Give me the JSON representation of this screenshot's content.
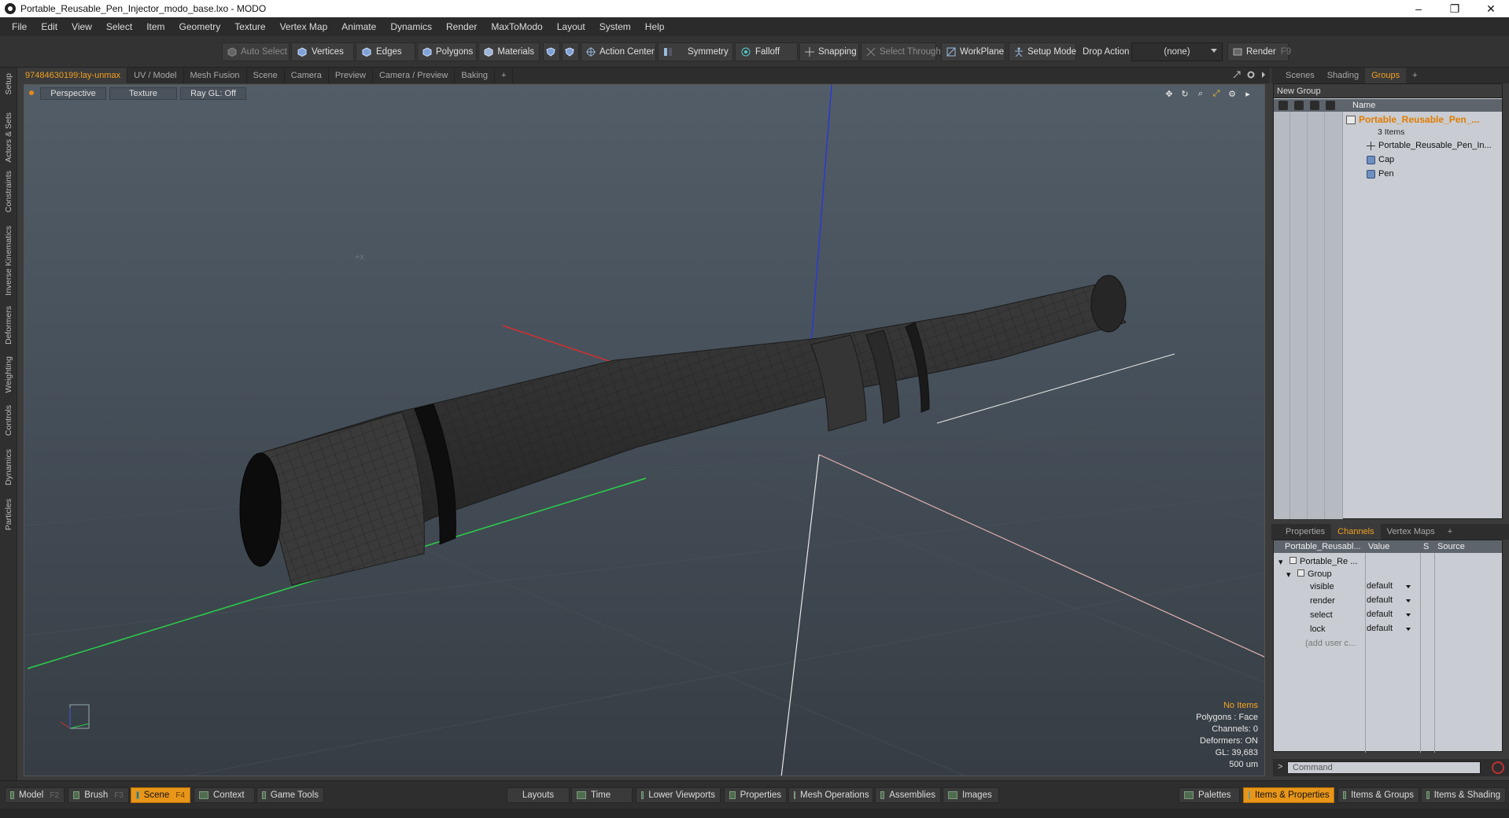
{
  "window": {
    "title": "Portable_Reusable_Pen_Injector_modo_base.lxo - MODO",
    "buttons": {
      "minimize": "–",
      "restore": "❐",
      "close": "✕"
    }
  },
  "menu": [
    "File",
    "Edit",
    "View",
    "Select",
    "Item",
    "Geometry",
    "Texture",
    "Vertex Map",
    "Animate",
    "Dynamics",
    "Render",
    "MaxToModo",
    "Layout",
    "System",
    "Help"
  ],
  "toolbar": {
    "auto_select": "Auto Select",
    "vertices": "Vertices",
    "edges": "Edges",
    "polygons": "Polygons",
    "materials": "Materials",
    "action_center": "Action Center",
    "symmetry": "Symmetry",
    "falloff": "Falloff",
    "snapping": "Snapping",
    "select_through": "Select Through",
    "workplane": "WorkPlane",
    "setup_mode": "Setup Mode",
    "drop_action": "Drop Action",
    "drop_action_value": "(none)",
    "render": "Render",
    "render_key": "F9"
  },
  "left_tabs": [
    "Setup",
    "Actors & Sets",
    "Constraints",
    "Inverse Kinematics",
    "Deformers",
    "Weighting",
    "Controls",
    "Dynamics",
    "Particles"
  ],
  "viewport_tabs": [
    "97484630199:lay-unmax",
    "UV / Model",
    "Mesh Fusion",
    "Scene",
    "Camera",
    "Preview",
    "Camera / Preview",
    "Baking",
    "+"
  ],
  "viewport": {
    "view": "Perspective",
    "shading": "Texture",
    "raygl": "Ray GL: Off",
    "stats": {
      "items": "No Items",
      "polygons": "Polygons : Face",
      "channels": "Channels: 0",
      "deformers": "Deformers: ON",
      "gl": "GL: 39,683",
      "scale": "500 um"
    }
  },
  "right_top_tabs": [
    "Scenes",
    "Shading",
    "Groups",
    "+"
  ],
  "groups": {
    "new_group": "New Group",
    "name_header": "Name",
    "root": "Portable_Reusable_Pen_...",
    "root_count": "3 Items",
    "children": [
      "Portable_Reusable_Pen_In...",
      "Cap",
      "Pen"
    ]
  },
  "right_mid_tabs": [
    "Properties",
    "Channels",
    "Vertex Maps",
    "+"
  ],
  "channels": {
    "headers": {
      "name": "Portable_Reusabl...",
      "value": "Value",
      "s": "S",
      "source": "Source"
    },
    "tree_root": "Portable_Re ...",
    "group": "Group",
    "rows": [
      {
        "name": "visible",
        "value": "default"
      },
      {
        "name": "render",
        "value": "default"
      },
      {
        "name": "select",
        "value": "default"
      },
      {
        "name": "lock",
        "value": "default"
      }
    ],
    "add_user": "(add user c..."
  },
  "command": {
    "prompt": ">",
    "placeholder": "Command"
  },
  "bottom": {
    "model": "Model",
    "model_key": "F2",
    "brush": "Brush",
    "brush_key": "F3",
    "scene": "Scene",
    "scene_key": "F4",
    "context": "Context",
    "game_tools": "Game Tools",
    "layouts": "Layouts",
    "time": "Time",
    "lower_viewports": "Lower Viewports",
    "properties": "Properties",
    "mesh_operations": "Mesh Operations",
    "assemblies": "Assemblies",
    "images": "Images",
    "palettes": "Palettes",
    "items_properties": "Items & Properties",
    "items_groups": "Items & Groups",
    "items_shading": "Items & Shading"
  },
  "colors": {
    "accent": "#e8961a",
    "axis_x": "#d03030",
    "axis_y": "#2bd04a",
    "axis_z": "#2a3ad0",
    "mesh": "#2a2a2a"
  }
}
